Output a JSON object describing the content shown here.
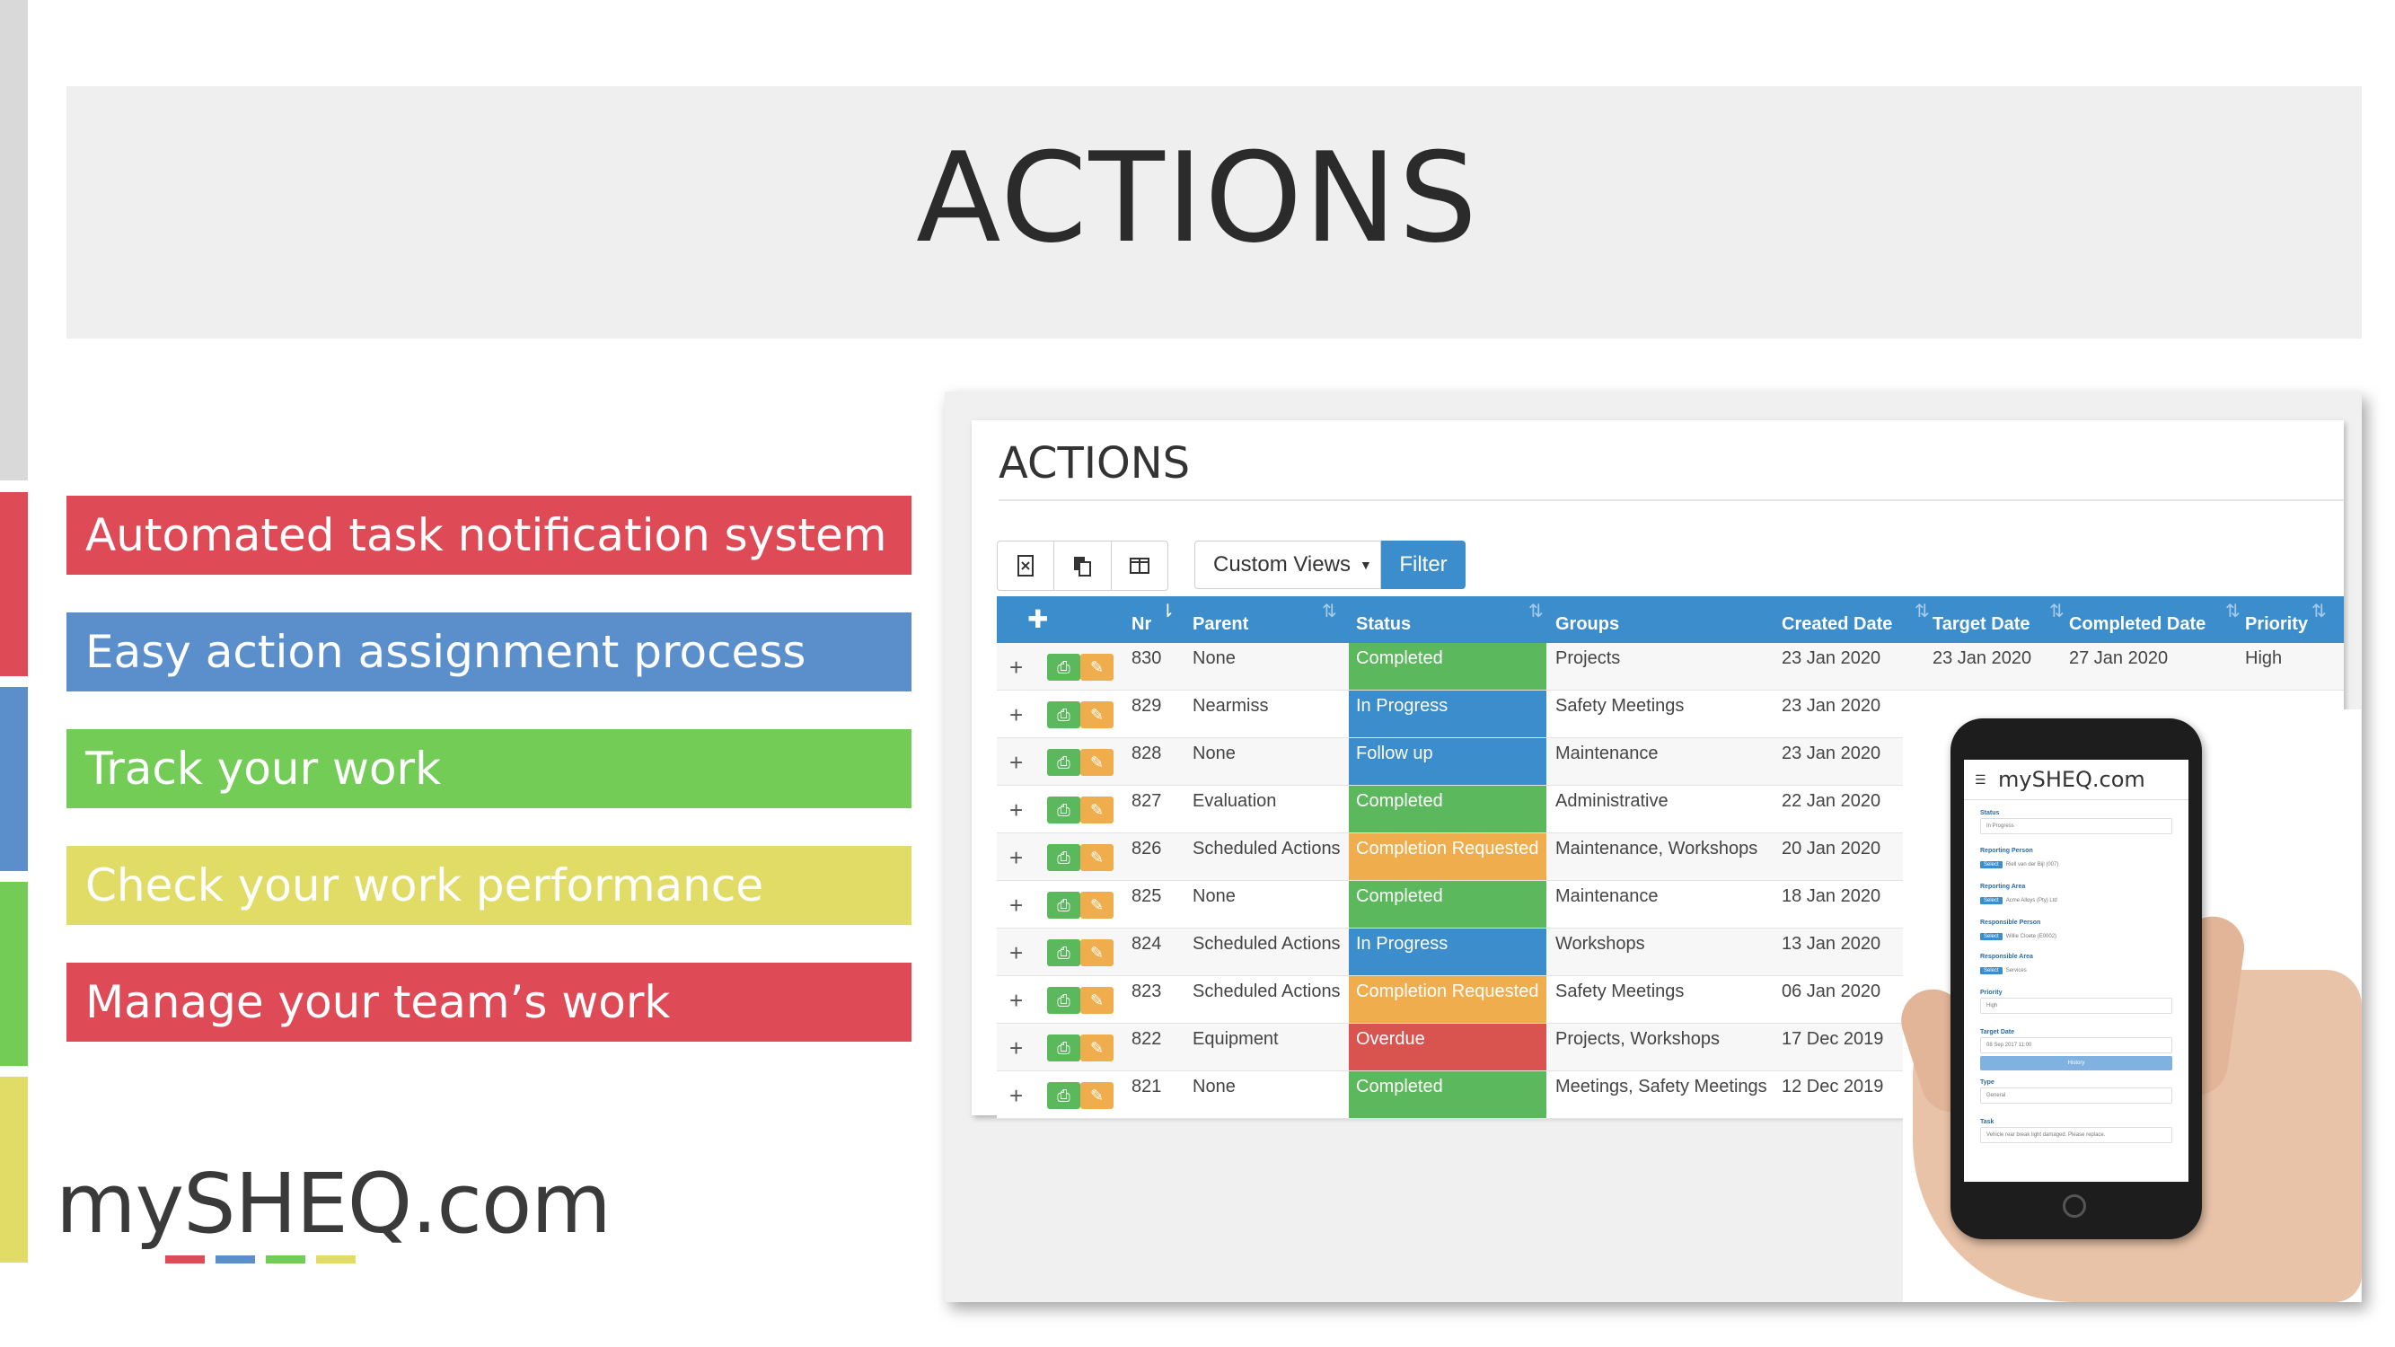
{
  "colors": {
    "red": "#de4a55",
    "blue": "#5b8fcb",
    "green": "#72cc55",
    "yellow": "#e1dc66",
    "gray": "#d9d9d9",
    "header_blue": "#3c8dcc",
    "status_completed": "#5cb85c",
    "status_inprogress": "#3c8dcc",
    "status_followup": "#3c8dcc",
    "status_completion_requested": "#f0ad4e",
    "status_overdue": "#d9534f"
  },
  "slide": {
    "title": "ACTIONS",
    "features": [
      {
        "label": "Automated task notification system",
        "color": "red"
      },
      {
        "label": "Easy action assignment process",
        "color": "blue"
      },
      {
        "label": "Track your work",
        "color": "green"
      },
      {
        "label": "Check your work performance",
        "color": "yellow"
      },
      {
        "label": "Manage your team’s work",
        "color": "red"
      }
    ],
    "logo": {
      "text": "mySHEQ.com"
    }
  },
  "app": {
    "page_title": "ACTIONS",
    "toolbar": {
      "export_icon": "excel-icon",
      "copy_icon": "copy-icon",
      "columns_icon": "columns-icon",
      "custom_views_label": "Custom Views",
      "filter_label": "Filter"
    },
    "table": {
      "add_icon": "plus-icon",
      "columns": [
        "Nr",
        "Parent",
        "Status",
        "Groups",
        "Created Date",
        "Target Date",
        "Completed Date",
        "Priority"
      ],
      "rows": [
        {
          "nr": "830",
          "parent": "None",
          "status": "Completed",
          "status_color": "status_completed",
          "groups": "Projects",
          "created": "23 Jan 2020",
          "target": "23 Jan 2020",
          "completed": "27 Jan 2020",
          "priority": "High"
        },
        {
          "nr": "829",
          "parent": "Nearmiss",
          "status": "In Progress",
          "status_color": "status_inprogress",
          "groups": "Safety Meetings",
          "created": "23 Jan 2020",
          "target": "",
          "completed": "",
          "priority": ""
        },
        {
          "nr": "828",
          "parent": "None",
          "status": "Follow up",
          "status_color": "status_followup",
          "groups": "Maintenance",
          "created": "23 Jan 2020",
          "target": "",
          "completed": "",
          "priority": ""
        },
        {
          "nr": "827",
          "parent": "Evaluation",
          "status": "Completed",
          "status_color": "status_completed",
          "groups": "Administrative",
          "created": "22 Jan 2020",
          "target": "",
          "completed": "",
          "priority": ""
        },
        {
          "nr": "826",
          "parent": "Scheduled Actions",
          "status": "Completion Requested",
          "status_color": "status_completion_requested",
          "groups": "Maintenance, Workshops",
          "created": "20 Jan 2020",
          "target": "",
          "completed": "",
          "priority": ""
        },
        {
          "nr": "825",
          "parent": "None",
          "status": "Completed",
          "status_color": "status_completed",
          "groups": "Maintenance",
          "created": "18 Jan 2020",
          "target": "",
          "completed": "",
          "priority": ""
        },
        {
          "nr": "824",
          "parent": "Scheduled Actions",
          "status": "In Progress",
          "status_color": "status_inprogress",
          "groups": "Workshops",
          "created": "13 Jan 2020",
          "target": "",
          "completed": "",
          "priority": ""
        },
        {
          "nr": "823",
          "parent": "Scheduled Actions",
          "status": "Completion Requested",
          "status_color": "status_completion_requested",
          "groups": "Safety Meetings",
          "created": "06 Jan 2020",
          "target": "",
          "completed": "",
          "priority": ""
        },
        {
          "nr": "822",
          "parent": "Equipment",
          "status": "Overdue",
          "status_color": "status_overdue",
          "groups": "Projects, Workshops",
          "created": "17 Dec 2019",
          "target": "",
          "completed": "",
          "priority": ""
        },
        {
          "nr": "821",
          "parent": "None",
          "status": "Completed",
          "status_color": "status_completed",
          "groups": "Meetings, Safety Meetings",
          "created": "12 Dec 2019",
          "target": "",
          "completed": "",
          "priority": ""
        }
      ]
    }
  },
  "mobile": {
    "logo": "mySHEQ.com",
    "fields": [
      {
        "label": "Status",
        "value": "In Progress",
        "kind": "select"
      },
      {
        "label": "Reporting Person",
        "value": "Riell van der Bijl (007)",
        "kind": "pick"
      },
      {
        "label": "Reporting Area",
        "value": "Acme Alloys (Pty) Ltd",
        "kind": "pick"
      },
      {
        "label": "Responsible Person",
        "value": "Willie Cloete (E0002)",
        "kind": "pick"
      },
      {
        "label": "Responsible Area",
        "value": "Services",
        "kind": "pick"
      },
      {
        "label": "Priority",
        "value": "High",
        "kind": "select"
      },
      {
        "label": "Target Date",
        "value": "08 Sep 2017 11:00",
        "kind": "input"
      },
      {
        "label": "Type",
        "value": "General",
        "kind": "select"
      },
      {
        "label": "Task",
        "value": "Vehicle rear break light damaged. Please replace.",
        "kind": "input"
      }
    ],
    "select_label": "Select",
    "history_label": "History"
  }
}
